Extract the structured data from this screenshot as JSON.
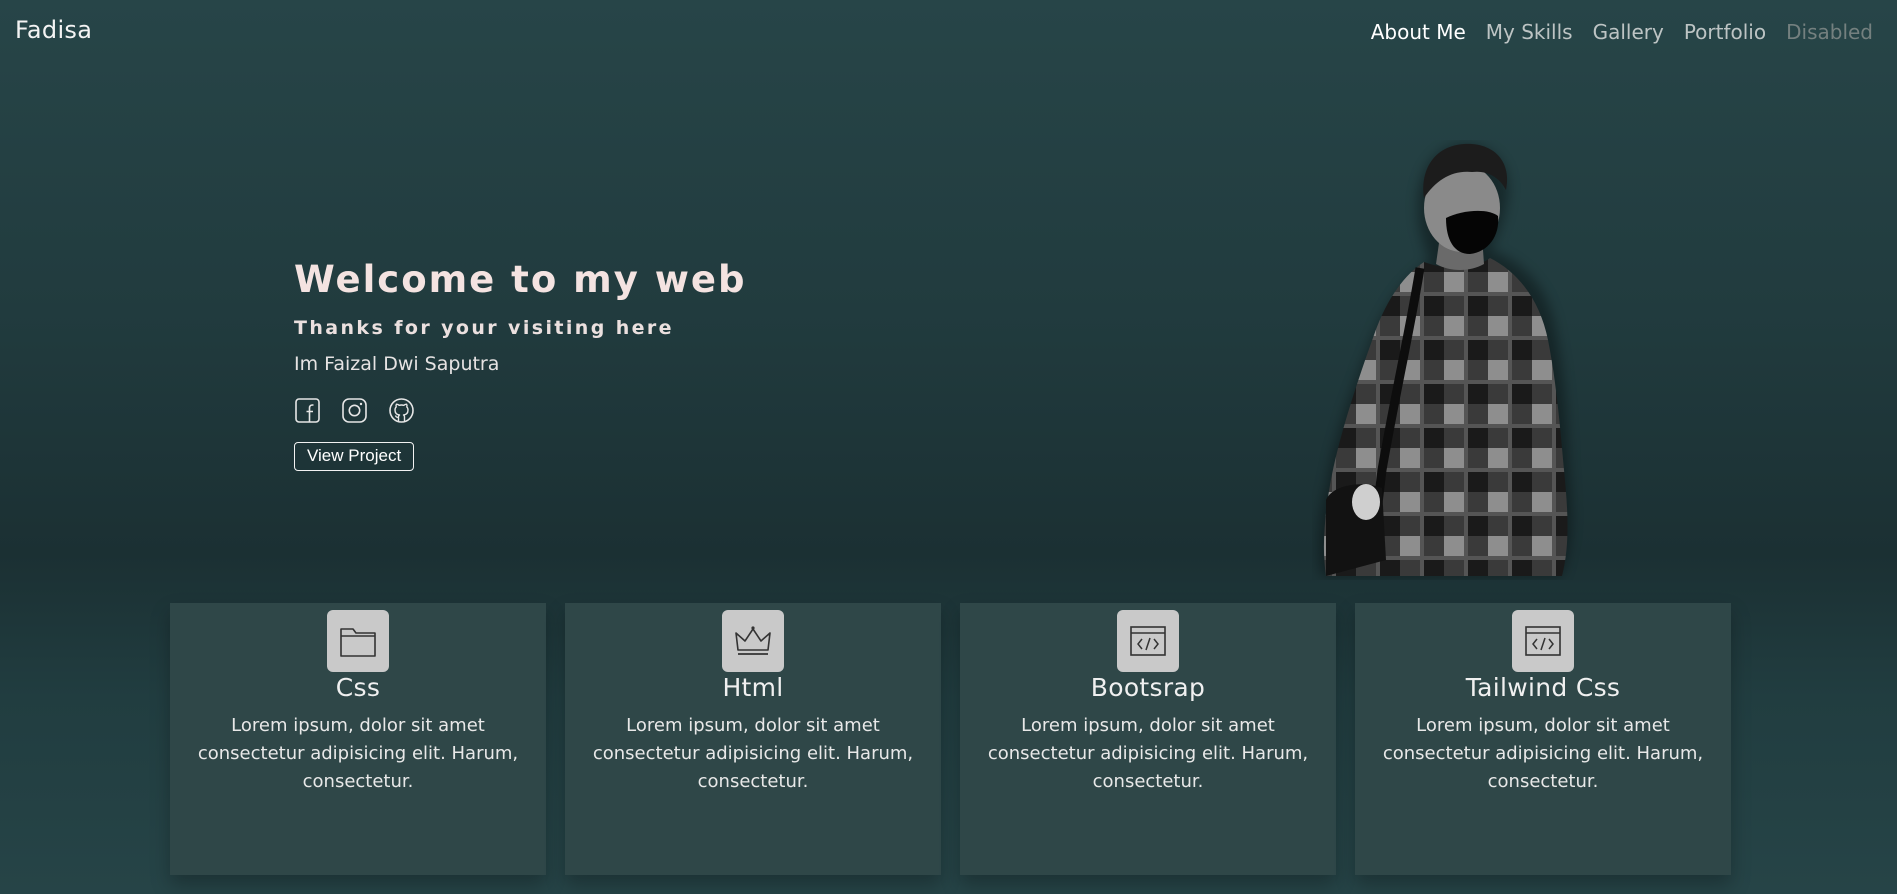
{
  "brand": "Fadisa",
  "nav": {
    "items": [
      {
        "label": "About Me",
        "state": "active"
      },
      {
        "label": "My Skills",
        "state": "normal"
      },
      {
        "label": "Gallery",
        "state": "normal"
      },
      {
        "label": "Portfolio",
        "state": "normal"
      },
      {
        "label": "Disabled",
        "state": "disabled"
      }
    ]
  },
  "hero": {
    "title": "Welcome to my web",
    "subtitle": "Thanks for your visiting here",
    "name": "Im Faizal Dwi Saputra",
    "socials": [
      "facebook-icon",
      "instagram-icon",
      "github-icon"
    ],
    "button_label": "View Project"
  },
  "cards": [
    {
      "icon": "folder-icon",
      "title": "Css",
      "text": "Lorem ipsum, dolor sit amet consectetur adipisicing elit. Harum, consectetur."
    },
    {
      "icon": "crown-icon",
      "title": "Html",
      "text": "Lorem ipsum, dolor sit amet consectetur adipisicing elit. Harum, consectetur."
    },
    {
      "icon": "code-window-icon",
      "title": "Bootsrap",
      "text": "Lorem ipsum, dolor sit amet consectetur adipisicing elit. Harum, consectetur."
    },
    {
      "icon": "code-window-icon",
      "title": "Tailwind Css",
      "text": "Lorem ipsum, dolor sit amet consectetur adipisicing elit. Harum, consectetur."
    }
  ],
  "colors": {
    "background_top": "#274548",
    "background_mid": "#1b3033",
    "card_bg": "#2f4748",
    "icon_tile": "#c9c9c9",
    "hero_text": "#f4e3e1"
  }
}
